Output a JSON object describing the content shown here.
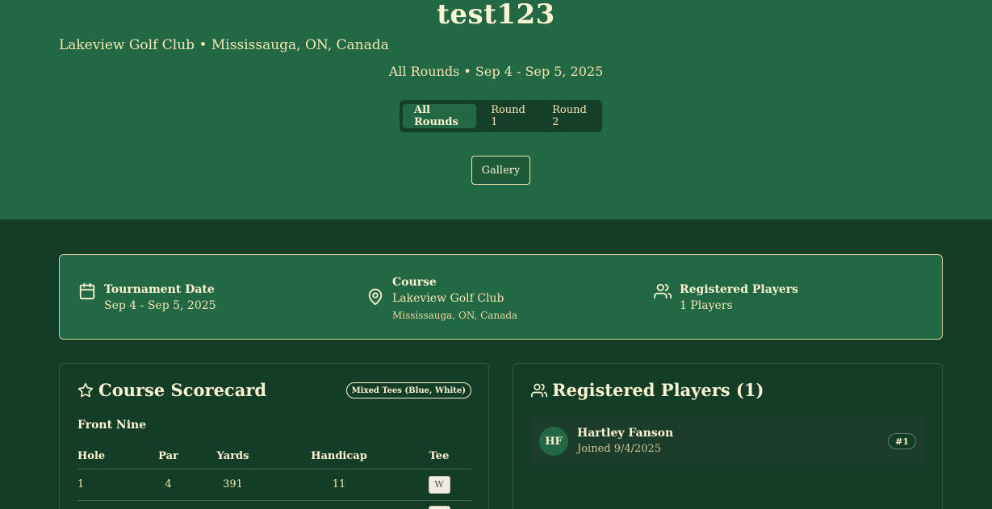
{
  "hero": {
    "title": "test123",
    "location": "Lakeview Golf Club • Mississauga, ON, Canada",
    "rounds_info": "All Rounds • Sep 4 - Sep 5, 2025",
    "tabs": [
      {
        "label": "All Rounds",
        "active": true
      },
      {
        "label": "Round 1",
        "active": false
      },
      {
        "label": "Round 2",
        "active": false
      }
    ],
    "gallery_label": "Gallery"
  },
  "info": {
    "date": {
      "label": "Tournament Date",
      "value": "Sep 4 - Sep 5, 2025",
      "icon": "calendar-icon"
    },
    "course": {
      "label": "Course",
      "value": "Lakeview Golf Club",
      "sub": "Mississauga, ON, Canada",
      "icon": "map-pin-icon"
    },
    "players": {
      "label": "Registered Players",
      "value": "1 Players",
      "icon": "users-icon"
    }
  },
  "scorecard": {
    "title": "Course Scorecard",
    "tee_badge": "Mixed Tees (Blue, White)",
    "section": "Front Nine",
    "headers": {
      "hole": "Hole",
      "par": "Par",
      "yards": "Yards",
      "handicap": "Handicap",
      "tee": "Tee"
    },
    "rows": [
      {
        "hole": "1",
        "par": "4",
        "yards": "391",
        "handicap": "11",
        "tee": "W"
      },
      {
        "hole": "",
        "par": "",
        "yards": "",
        "handicap": "",
        "tee": ""
      }
    ]
  },
  "players_panel": {
    "title": "Registered Players (1)",
    "players": [
      {
        "initials": "HF",
        "name": "Hartley Fanson",
        "joined": "Joined 9/4/2025",
        "rank": "#1"
      }
    ]
  },
  "colors": {
    "hero_bg": "#236844",
    "page_bg": "#143d27",
    "accent_text": "#f3e7b3"
  }
}
